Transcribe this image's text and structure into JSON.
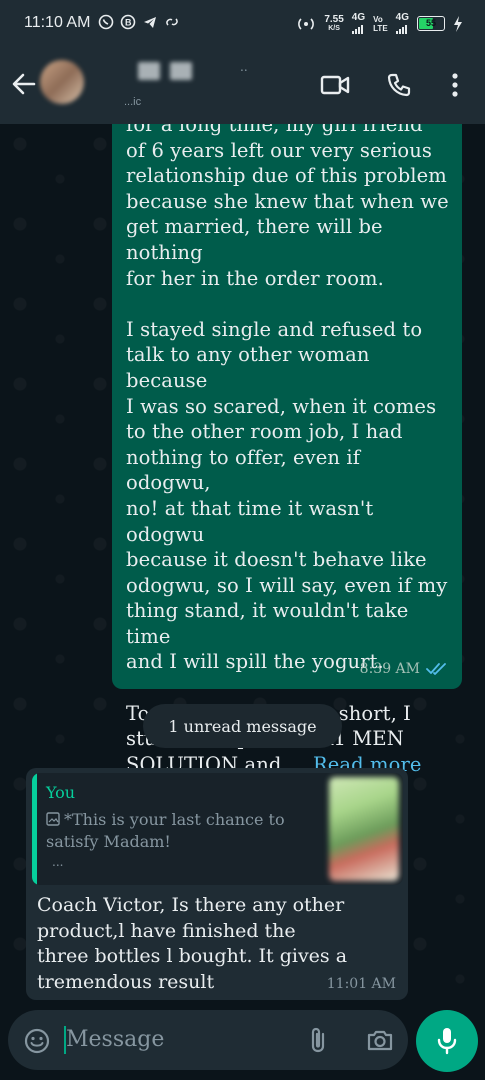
{
  "statusbar": {
    "time": "11:10 AM",
    "left_icons": [
      "whatsapp-icon",
      "b-icon",
      "telegram-icon",
      "link-icon"
    ],
    "speed_value": "7.55",
    "speed_unit": "K/S",
    "net1": "4G",
    "net2_top": "Vo",
    "net2_bottom": "LTE",
    "net3": "4G",
    "battery": "55"
  },
  "header": {
    "subtitle": "...ic",
    "dots": ".."
  },
  "outgoing": {
    "text": "for a long time, my girl friend\nof 6 years left our very serious\nrelationship due of this problem\nbecause she knew that when we\nget married, there will be nothing\nfor her in the order room.\n\nI stayed single and refused to\ntalk to any other woman because\nI was so scared, when it comes\nto the other room job, I had\nnothing to offer, even if odogwu,\nno! at that time it wasn't odogwu\nbecause it doesn't behave like\nodogwu, so I will say, even if my\nthing stand, it wouldn't take time\nand I will spill the yogurt.\n\nTo cut the long story short, I\nstumbled upon the A1 MEN\nSOLUTION and ... ",
    "read_more": "Read more",
    "time": "8:39 AM"
  },
  "unread_label": "1 unread message",
  "incoming": {
    "quote_author": "You",
    "quote_text": "*This is your last chance to satisfy Madam!",
    "quote_more": "...",
    "text": "Coach Victor, Is there any other\nproduct,l have finished the\nthree bottles l bought. It gives a\ntremendous result",
    "time": "11:01 AM"
  },
  "input": {
    "placeholder": "Message"
  },
  "colors": {
    "outgoing_bubble": "#005c4b",
    "incoming_bubble": "#1f2c34",
    "accent": "#00a884",
    "link": "#53bdeb",
    "quote_author": "#06cf9c"
  }
}
